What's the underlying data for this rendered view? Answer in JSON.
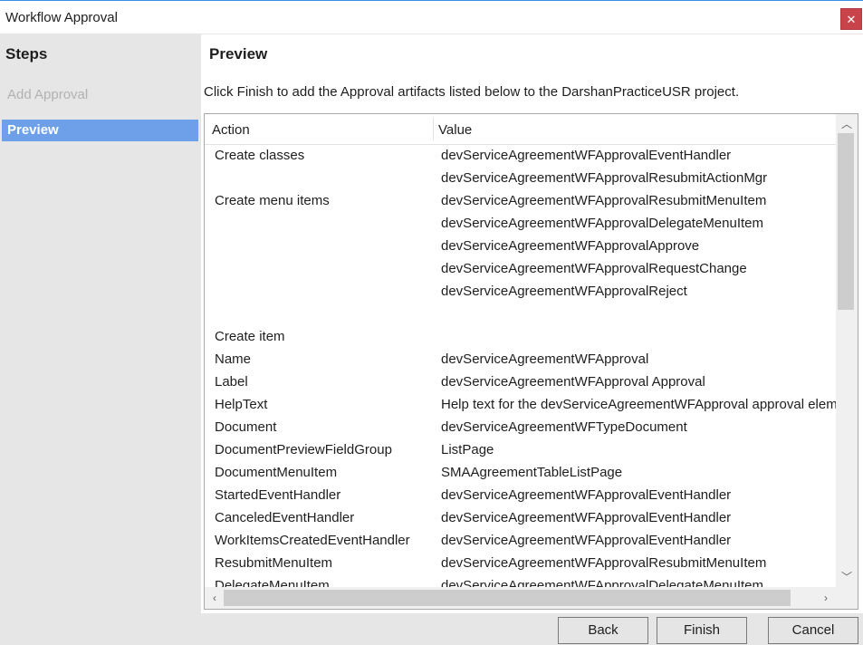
{
  "window": {
    "title": "Workflow Approval",
    "close_glyph": "✕"
  },
  "sidebar": {
    "heading": "Steps",
    "items": [
      {
        "label": "Add Approval",
        "state": "disabled"
      },
      {
        "label": "Preview",
        "state": "selected"
      }
    ]
  },
  "main": {
    "title": "Preview",
    "instructions": "Click Finish to add the Approval artifacts listed below to the DarshanPracticeUSR project.",
    "grid": {
      "columns": [
        "Action",
        "Value"
      ],
      "rows": [
        {
          "action": "Create classes",
          "value": "devServiceAgreementWFApprovalEventHandler"
        },
        {
          "action": "",
          "value": "devServiceAgreementWFApprovalResubmitActionMgr"
        },
        {
          "action": "Create menu items",
          "value": "devServiceAgreementWFApprovalResubmitMenuItem"
        },
        {
          "action": "",
          "value": "devServiceAgreementWFApprovalDelegateMenuItem"
        },
        {
          "action": "",
          "value": "devServiceAgreementWFApprovalApprove"
        },
        {
          "action": "",
          "value": "devServiceAgreementWFApprovalRequestChange"
        },
        {
          "action": "",
          "value": "devServiceAgreementWFApprovalReject"
        },
        {
          "action": "",
          "value": ""
        },
        {
          "action": "Create item",
          "value": ""
        },
        {
          "action": "Name",
          "value": "devServiceAgreementWFApproval"
        },
        {
          "action": "Label",
          "value": "devServiceAgreementWFApproval Approval"
        },
        {
          "action": "HelpText",
          "value": "Help text for the devServiceAgreementWFApproval approval elem"
        },
        {
          "action": "Document",
          "value": "devServiceAgreementWFTypeDocument"
        },
        {
          "action": "DocumentPreviewFieldGroup",
          "value": "ListPage"
        },
        {
          "action": "DocumentMenuItem",
          "value": "SMAAgreementTableListPage"
        },
        {
          "action": "StartedEventHandler",
          "value": "devServiceAgreementWFApprovalEventHandler"
        },
        {
          "action": "CanceledEventHandler",
          "value": "devServiceAgreementWFApprovalEventHandler"
        },
        {
          "action": "WorkItemsCreatedEventHandler",
          "value": "devServiceAgreementWFApprovalEventHandler"
        },
        {
          "action": "ResubmitMenuItem",
          "value": "devServiceAgreementWFApprovalResubmitMenuItem"
        },
        {
          "action": "DelegateMenuItem",
          "value": "devServiceAgreementWFApprovalDelegateMenuItem"
        }
      ]
    },
    "scroll_arrows": {
      "up": "︿",
      "down": "﹀",
      "left": "‹",
      "right": "›"
    }
  },
  "footer": {
    "back_label": "Back",
    "finish_label": "Finish",
    "cancel_label": "Cancel"
  }
}
